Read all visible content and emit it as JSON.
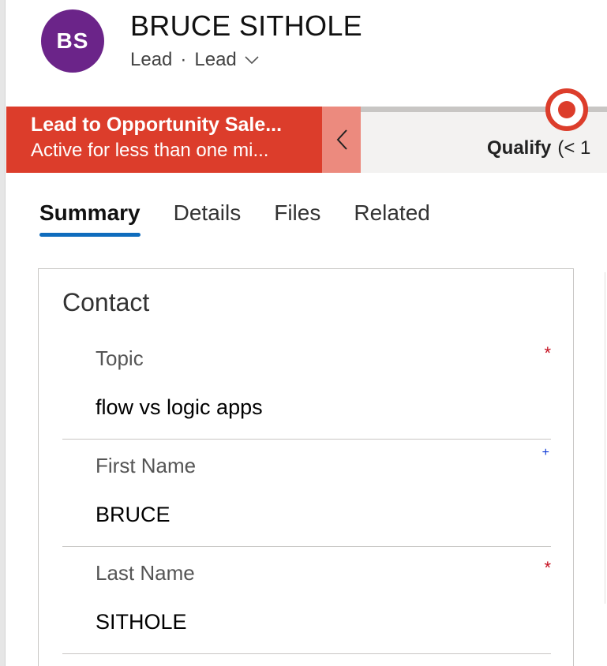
{
  "record": {
    "initials": "BS",
    "name": "BRUCE SITHOLE",
    "entity": "Lead",
    "separator": "·",
    "form": "Lead",
    "avatar_color": "#6b2489"
  },
  "process": {
    "active_stage_name": "Lead to Opportunity Sale...",
    "active_duration": "Active for less than one mi...",
    "next_stage": "Qualify",
    "next_stage_duration": "(< 1",
    "accent": "#dc3d2b"
  },
  "tabs": [
    {
      "label": "Summary",
      "selected": true
    },
    {
      "label": "Details",
      "selected": false
    },
    {
      "label": "Files",
      "selected": false
    },
    {
      "label": "Related",
      "selected": false
    }
  ],
  "section": {
    "title": "Contact",
    "fields": [
      {
        "label": "Topic",
        "value": "flow vs logic apps",
        "indicator": "*"
      },
      {
        "label": "First Name",
        "value": "BRUCE",
        "indicator": "+"
      },
      {
        "label": "Last Name",
        "value": "SITHOLE",
        "indicator": "*"
      }
    ]
  }
}
